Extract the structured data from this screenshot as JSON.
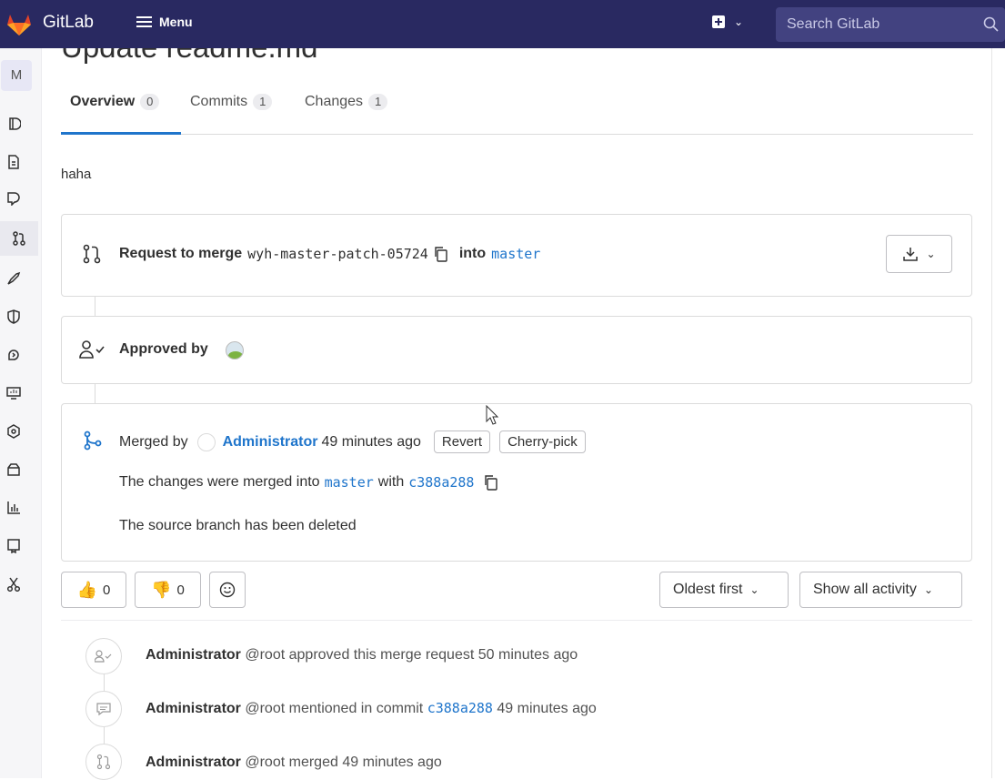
{
  "topbar": {
    "brand": "GitLab",
    "menu_label": "Menu",
    "search_placeholder": "Search GitLab"
  },
  "sidebar": {
    "project_initial": "M",
    "icons": [
      "project-overview-icon",
      "repository-icon",
      "issues-icon",
      "merge-requests-icon",
      "deployments-icon",
      "security-icon",
      "infrastructure-icon",
      "monitor-icon",
      "analytics-icon",
      "packages-icon",
      "analytics-chart-icon",
      "wiki-icon",
      "snippets-icon"
    ]
  },
  "page": {
    "title": "Update readme.md",
    "tabs": [
      {
        "label": "Overview",
        "count": "0"
      },
      {
        "label": "Commits",
        "count": "1"
      },
      {
        "label": "Changes",
        "count": "1"
      }
    ],
    "description": "haha"
  },
  "merge_request": {
    "request_label": "Request to merge",
    "source_branch": "wyh-master-patch-05724",
    "into_label": "into",
    "target_branch": "master"
  },
  "approval": {
    "label": "Approved by"
  },
  "merged": {
    "label": "Merged by",
    "user": "Administrator",
    "time": "49 minutes ago",
    "revert_label": "Revert",
    "cherry_pick_label": "Cherry-pick",
    "changes_prefix": "The changes were merged into",
    "branch": "master",
    "with_label": "with",
    "commit": "c388a288",
    "source_deleted": "The source branch has been deleted"
  },
  "awards": {
    "thumbs_up_count": "0",
    "thumbs_down_count": "0"
  },
  "filters": {
    "sort_label": "Oldest first",
    "activity_label": "Show all activity"
  },
  "timeline": [
    {
      "author": "Administrator",
      "handle": "@root",
      "action": "approved this merge request",
      "time": "50 minutes ago"
    },
    {
      "author": "Administrator",
      "handle": "@root",
      "action": "mentioned in commit",
      "commit": "c388a288",
      "time": "49 minutes ago"
    },
    {
      "author": "Administrator",
      "handle": "@root",
      "action": "merged",
      "time": "49 minutes ago"
    }
  ]
}
